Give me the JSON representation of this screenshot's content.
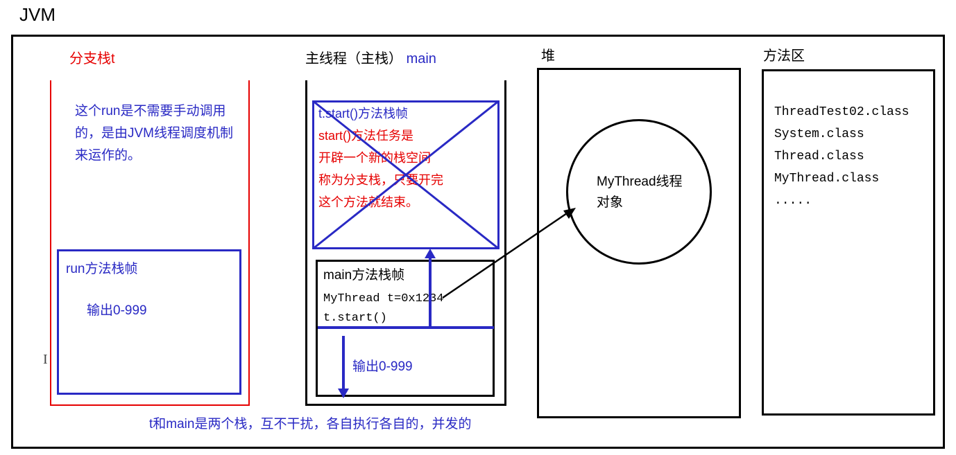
{
  "title": "JVM",
  "branch_stack": {
    "title": "分支栈t",
    "note": "这个run是不需要手动调用的，是由JVM线程调度机制来运作的。",
    "run_frame_title": "run方法栈帧",
    "run_frame_content": "输出0-999"
  },
  "main_stack": {
    "title_black": "主线程（主栈）",
    "title_blue": "main",
    "start_frame": {
      "line1": "t.start()方法栈帧",
      "line2": "start()方法任务是",
      "line3": "开辟一个新的栈空间",
      "line4": "称为分支栈，只要开完",
      "line5": "这个方法就结束。"
    },
    "main_frame": {
      "title": "main方法栈帧",
      "code_line1": "MyThread t=0x1234",
      "code_line2": "t.start()",
      "output": "输出0-999"
    }
  },
  "heap": {
    "title": "堆",
    "object_line1": "MyThread线程",
    "object_line2": "对象"
  },
  "method_area": {
    "title": "方法区",
    "classes": [
      "ThreadTest02.class",
      "System.class",
      "Thread.class",
      "MyThread.class",
      "....."
    ]
  },
  "bottom_note": "t和main是两个栈，互不干扰，各自执行各自的，并发的",
  "cursor": "I"
}
